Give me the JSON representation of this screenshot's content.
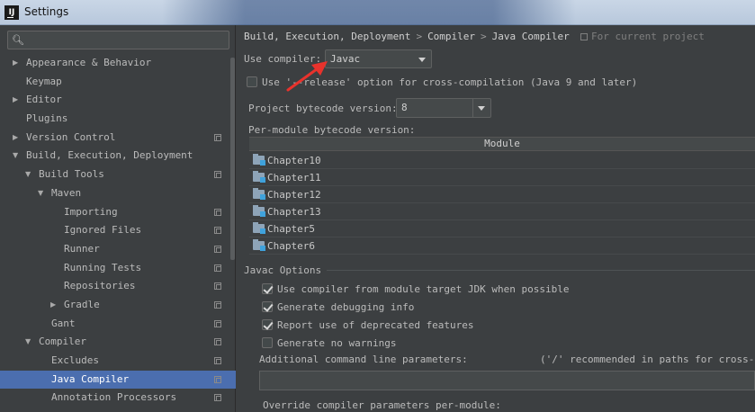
{
  "window": {
    "title": "Settings",
    "app_icon_letter": "IJ"
  },
  "search": {
    "placeholder": "",
    "value": ""
  },
  "tree": [
    {
      "label": "Appearance & Behavior",
      "level": 0,
      "arrow": "right",
      "project": false
    },
    {
      "label": "Keymap",
      "level": 0,
      "arrow": "none",
      "project": false
    },
    {
      "label": "Editor",
      "level": 0,
      "arrow": "right",
      "project": false
    },
    {
      "label": "Plugins",
      "level": 0,
      "arrow": "none",
      "project": false
    },
    {
      "label": "Version Control",
      "level": 0,
      "arrow": "right",
      "project": true
    },
    {
      "label": "Build, Execution, Deployment",
      "level": 0,
      "arrow": "down",
      "project": false
    },
    {
      "label": "Build Tools",
      "level": 1,
      "arrow": "down",
      "project": true
    },
    {
      "label": "Maven",
      "level": 2,
      "arrow": "down",
      "project": false
    },
    {
      "label": "Importing",
      "level": 4,
      "arrow": "none",
      "project": true
    },
    {
      "label": "Ignored Files",
      "level": 4,
      "arrow": "none",
      "project": true
    },
    {
      "label": "Runner",
      "level": 4,
      "arrow": "none",
      "project": true
    },
    {
      "label": "Running Tests",
      "level": 4,
      "arrow": "none",
      "project": true
    },
    {
      "label": "Repositories",
      "level": 4,
      "arrow": "none",
      "project": true
    },
    {
      "label": "Gradle",
      "level": 3,
      "arrow": "right",
      "project": true
    },
    {
      "label": "Gant",
      "level": 3,
      "arrow": "none",
      "project": true
    },
    {
      "label": "Compiler",
      "level": 1,
      "arrow": "down",
      "project": true
    },
    {
      "label": "Excludes",
      "level": 3,
      "arrow": "none",
      "project": true
    },
    {
      "label": "Java Compiler",
      "level": 3,
      "arrow": "none",
      "project": true,
      "selected": true
    },
    {
      "label": "Annotation Processors",
      "level": 3,
      "arrow": "none",
      "project": true
    }
  ],
  "breadcrumb": {
    "part1": "Build, Execution, Deployment",
    "part2": "Compiler",
    "part3": "Java Compiler",
    "separator": ">"
  },
  "for_project": "For current project",
  "use_compiler": {
    "label": "Use compiler:",
    "value": "Javac"
  },
  "release_option": {
    "label": "Use '--release' option for cross-compilation (Java 9 and later)",
    "checked": false
  },
  "bytecode": {
    "label": "Project bytecode version:",
    "value": "8"
  },
  "per_module": {
    "label": "Per-module bytecode version:",
    "header": "Module",
    "modules": [
      "Chapter10",
      "Chapter11",
      "Chapter12",
      "Chapter13",
      "Chapter5",
      "Chapter6"
    ]
  },
  "javac_options": {
    "title": "Javac Options",
    "options": [
      {
        "label": "Use compiler from module target JDK when possible",
        "checked": true
      },
      {
        "label": "Generate debugging info",
        "checked": true
      },
      {
        "label": "Report use of deprecated features",
        "checked": true
      },
      {
        "label": "Generate no warnings",
        "checked": false
      }
    ],
    "additional_label": "Additional command line parameters:",
    "additional_hint": "('/' recommended in paths for cross-plat",
    "additional_value": "",
    "override_label": "Override compiler parameters per-module:"
  },
  "colors": {
    "accent": "#4b6eaf",
    "annotation_arrow": "#e8322c"
  }
}
